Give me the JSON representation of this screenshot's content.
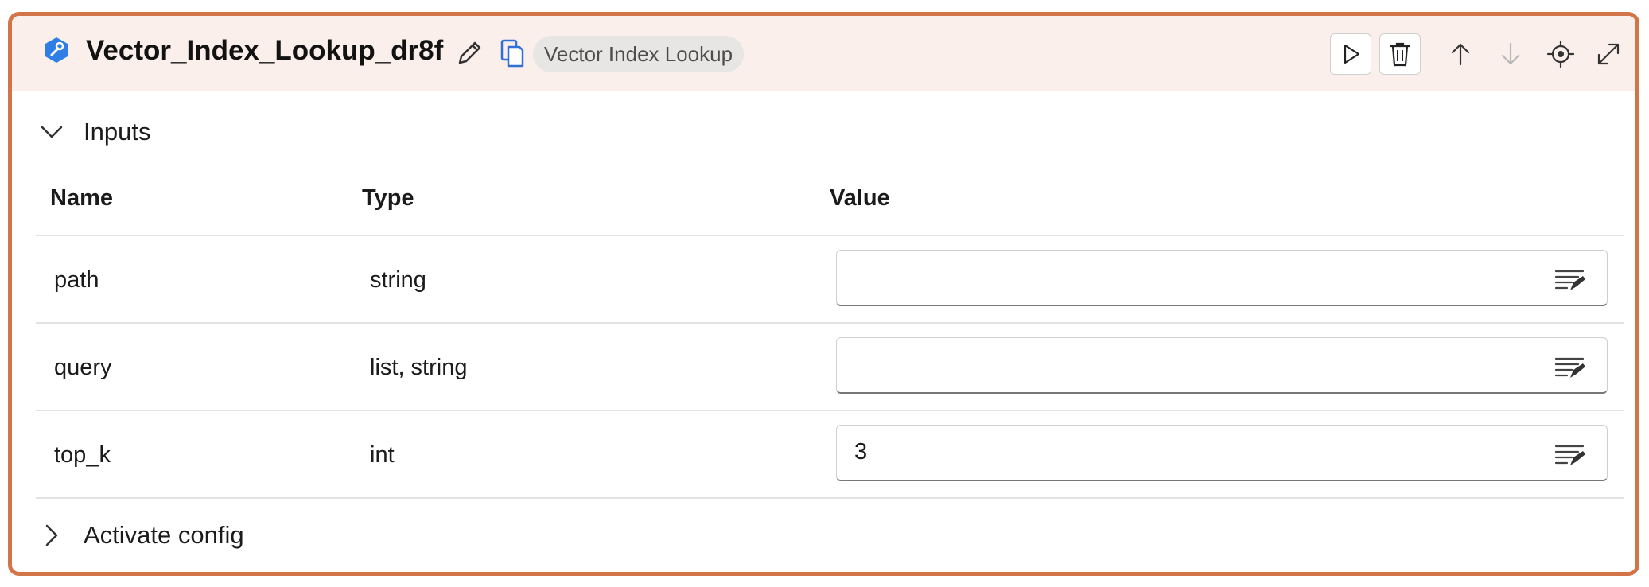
{
  "node": {
    "name": "Vector_Index_Lookup_dr8f",
    "tool_badge": "Vector Index Lookup",
    "icon": "wrench-hexagon-icon",
    "accent_color": "#d2764a",
    "header_bg": "#fbefeb"
  },
  "toolbar": {
    "buttons": [
      "run-icon",
      "delete-icon",
      "move-up-icon",
      "move-down-icon",
      "locate-icon",
      "expand-icon"
    ]
  },
  "inputs": {
    "section_title": "Inputs",
    "expanded": true,
    "columns": [
      "Name",
      "Type",
      "Value"
    ],
    "rows": [
      {
        "name": "path",
        "type": "string",
        "value": ""
      },
      {
        "name": "query",
        "type": "list, string",
        "value": ""
      },
      {
        "name": "top_k",
        "type": "int",
        "value": "3"
      }
    ]
  },
  "activate_config": {
    "section_title": "Activate config",
    "expanded": false
  }
}
